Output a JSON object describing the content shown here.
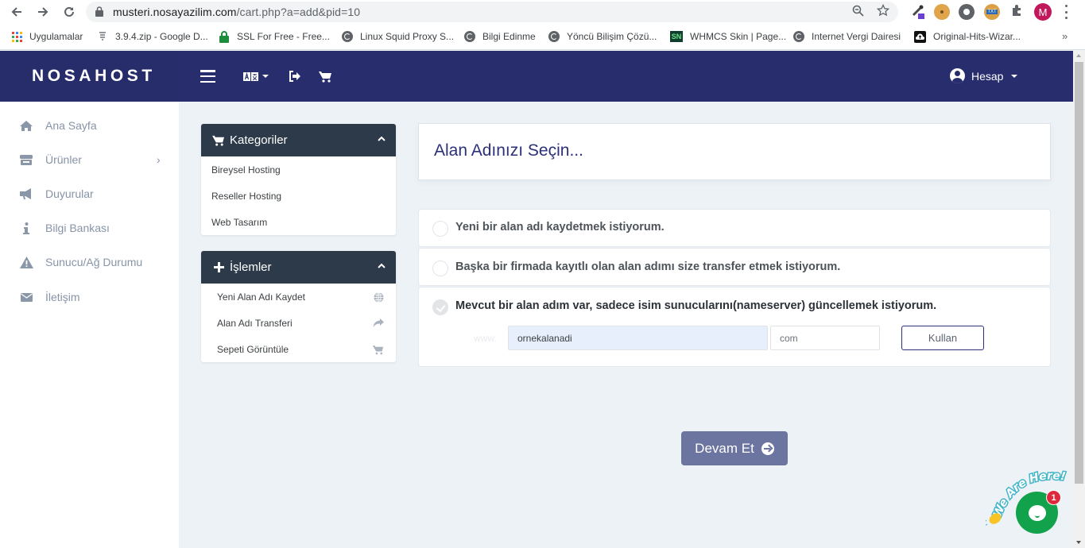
{
  "browser": {
    "url_host": "musteri.nosayazilim.com",
    "url_path": "/cart.php?a=add&pid=10",
    "profile_initial": "M",
    "bookmarks": [
      {
        "label": "Uygulamalar",
        "icon": "apps-grid-icon"
      },
      {
        "label": "3.9.4.zip - Google D...",
        "icon": "file-icon"
      },
      {
        "label": "SSL For Free - Free...",
        "icon": "padlock-icon"
      },
      {
        "label": "Linux Squid Proxy S...",
        "icon": "globe-icon"
      },
      {
        "label": "Bilgi Edinme",
        "icon": "globe-icon"
      },
      {
        "label": "Yöncü Bilişim Çözü...",
        "icon": "globe-icon"
      },
      {
        "label": "WHMCS Skin | Page...",
        "icon": "sn-logo-icon"
      },
      {
        "label": "Internet Vergi Dairesi",
        "icon": "globe-icon"
      },
      {
        "label": "Original-Hits-Wizar...",
        "icon": "cloud-upload-icon"
      }
    ],
    "bookmarks_more": "»"
  },
  "header": {
    "brand": "NOSAHOST",
    "account_label": "Hesap",
    "colors": {
      "header_bg": "#282d6e",
      "accent": "#2b3079"
    }
  },
  "sidebar": {
    "items": [
      {
        "label": "Ana Sayfa",
        "icon": "home-icon"
      },
      {
        "label": "Ürünler",
        "icon": "store-icon",
        "has_children": true,
        "chevron": "›"
      },
      {
        "label": "Duyurular",
        "icon": "megaphone-icon"
      },
      {
        "label": "Bilgi Bankası",
        "icon": "info-icon"
      },
      {
        "label": "Sunucu/Ağ Durumu",
        "icon": "warning-icon"
      },
      {
        "label": "İletişim",
        "icon": "envelope-icon"
      }
    ]
  },
  "categories_panel": {
    "title": "Kategoriler",
    "items": [
      "Bireysel Hosting",
      "Reseller Hosting",
      "Web Tasarım"
    ]
  },
  "actions_panel": {
    "title": "İşlemler",
    "items": [
      {
        "label": "Yeni Alan Adı Kaydet",
        "icon": "globe-icon"
      },
      {
        "label": "Alan Adı Transferi",
        "icon": "share-arrow-icon"
      },
      {
        "label": "Sepeti Görüntüle",
        "icon": "cart-icon"
      }
    ]
  },
  "main": {
    "title": "Alan Adınızı Seçin...",
    "options": [
      {
        "label": "Yeni bir alan adı kaydetmek istiyorum.",
        "selected": false
      },
      {
        "label": "Başka bir firmada kayıtlı olan alan adımı size transfer etmek istiyorum.",
        "selected": false
      },
      {
        "label": "Mevcut bir alan adım var, sadece isim sunucularını(nameserver) güncellemek istiyorum.",
        "selected": true
      }
    ],
    "www_prefix": "www.",
    "domain_value": "ornekalanadi",
    "tld_value": "com",
    "use_button": "Kullan",
    "continue_button": "Devam Et"
  },
  "chat": {
    "banner_text": "We Are Here!",
    "badge_count": "1"
  }
}
